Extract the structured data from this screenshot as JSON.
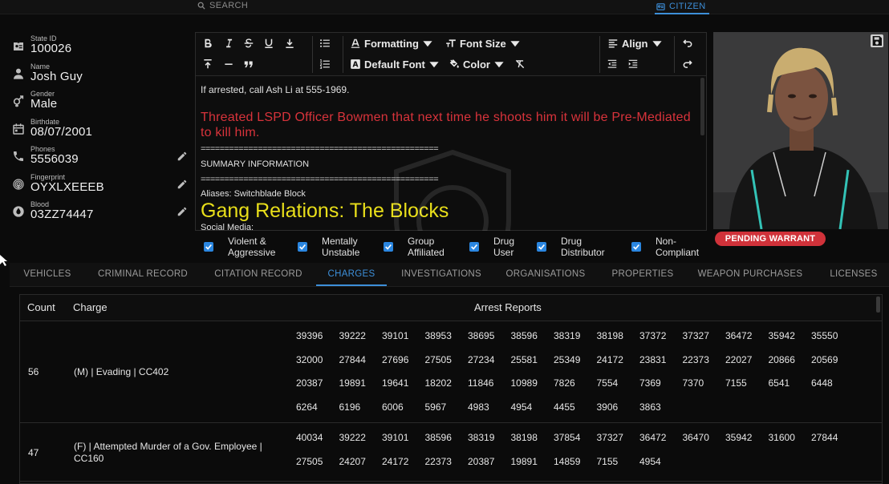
{
  "topbar": {
    "search_label": "SEARCH",
    "citizen_label": "CITIZEN"
  },
  "profile": {
    "state_id": {
      "label": "State ID",
      "value": "100026"
    },
    "name": {
      "label": "Name",
      "value": "Josh Guy"
    },
    "gender": {
      "label": "Gender",
      "value": "Male"
    },
    "birthdate": {
      "label": "Birthdate",
      "value": "08/07/2001"
    },
    "phones": {
      "label": "Phones",
      "value": "5556039"
    },
    "fingerprint": {
      "label": "Fingerprint",
      "value": "OYXLXEEEB"
    },
    "blood": {
      "label": "Blood",
      "value": "03ZZ74447"
    }
  },
  "toolbar": {
    "formatting": "Formatting",
    "font_size": "Font Size",
    "default_font": "Default Font",
    "color": "Color",
    "align": "Align"
  },
  "notes": {
    "line1": "If arrested, call Ash Li at 555-1969.",
    "threat": "Threated LSPD Officer Bowmen that next time he shoots him it will be Pre-Mediated to kill him.",
    "rule1": "==================================================",
    "summary": "SUMMARY INFORMATION",
    "rule2": "==================================================",
    "aliases": "Aliases: Switchblade Block",
    "gang": "Gang Relations: The Blocks",
    "social": "Social Media:"
  },
  "colors": {
    "accent": "#3d8fd9",
    "warrant": "#d0323a",
    "threat_text": "#d8333b",
    "gang_text": "#e9df1a"
  },
  "warrant_badge": "PENDING WARRANT",
  "tags": [
    {
      "line1": "Violent &",
      "line2": "Aggressive",
      "checked": true
    },
    {
      "line1": "Mentally",
      "line2": "Unstable",
      "checked": true
    },
    {
      "line1": "Group",
      "line2": "Affiliated",
      "checked": true
    },
    {
      "line1": "Drug",
      "line2": "User",
      "checked": true
    },
    {
      "line1": "Drug",
      "line2": "Distributor",
      "checked": true
    },
    {
      "line1": "Non-",
      "line2": "Compliant",
      "checked": true
    }
  ],
  "tabs": [
    {
      "label": "VEHICLES",
      "active": false
    },
    {
      "label": "CRIMINAL RECORD",
      "active": false
    },
    {
      "label": "CITATION RECORD",
      "active": false
    },
    {
      "label": "CHARGES",
      "active": true
    },
    {
      "label": "INVESTIGATIONS",
      "active": false
    },
    {
      "label": "ORGANISATIONS",
      "active": false
    },
    {
      "label": "PROPERTIES",
      "active": false
    },
    {
      "label": "WEAPON PURCHASES",
      "active": false
    },
    {
      "label": "LICENSES",
      "active": false
    }
  ],
  "table": {
    "headers": {
      "count": "Count",
      "charge": "Charge",
      "reports": "Arrest Reports"
    },
    "rows": [
      {
        "count": "56",
        "charge": "(M) | Evading | CC402",
        "reports": [
          "39396",
          "39222",
          "39101",
          "38953",
          "38695",
          "38596",
          "38319",
          "38198",
          "37372",
          "37327",
          "36472",
          "35942",
          "35550",
          "32000",
          "27844",
          "27696",
          "27505",
          "27234",
          "25581",
          "25349",
          "24172",
          "23831",
          "22373",
          "22027",
          "20866",
          "20569",
          "20387",
          "19891",
          "19641",
          "18202",
          "11846",
          "10989",
          "7826",
          "7554",
          "7369",
          "7370",
          "7155",
          "6541",
          "6448",
          "6264",
          "6196",
          "6006",
          "5967",
          "4983",
          "4954",
          "4455",
          "3906",
          "3863"
        ]
      },
      {
        "count": "47",
        "charge": "(F) | Attempted Murder of a Gov. Employee | CC160",
        "reports": [
          "40034",
          "39222",
          "39101",
          "38596",
          "38319",
          "38198",
          "37854",
          "37327",
          "36472",
          "36470",
          "35942",
          "31600",
          "27844",
          "27505",
          "24207",
          "24172",
          "22373",
          "20387",
          "19891",
          "14859",
          "7155",
          "4954"
        ]
      }
    ]
  }
}
